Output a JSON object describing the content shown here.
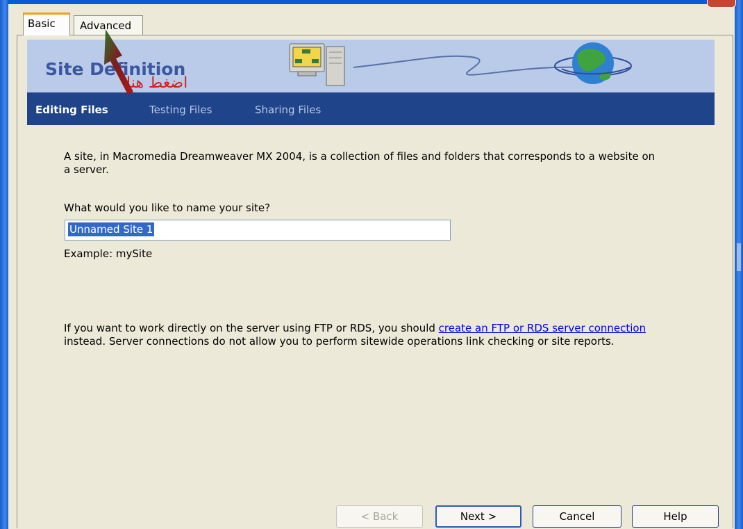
{
  "tabs": {
    "basic": "Basic",
    "advanced": "Advanced"
  },
  "banner": {
    "title": "Site Definition"
  },
  "annotation": {
    "arabic": "اضغط هنا"
  },
  "nav": {
    "items": [
      "Editing Files",
      "Testing Files",
      "Sharing Files"
    ],
    "active": "Editing Files"
  },
  "content": {
    "intro": "A site, in Macromedia Dreamweaver MX 2004, is a collection of files and folders that corresponds to a website on a server.",
    "question": "What would you like to name your site?",
    "site_name_value": "Unnamed Site 1",
    "example": "Example: mySite",
    "server_before": "If you want to work directly on the server using FTP or RDS, you should ",
    "server_link": "create an FTP or RDS server connection",
    "server_after": " instead. Server connections do not allow you to perform sitewide operations link checking or site reports."
  },
  "buttons": {
    "back": "< Back",
    "next": "Next >",
    "cancel": "Cancel",
    "help": "Help"
  },
  "colors": {
    "nav_bg": "#1f4489",
    "banner_bg": "#b9cbe9",
    "title": "#3b57a0",
    "annotation": "#d21e1e",
    "selection": "#316ac5"
  },
  "icons": [
    "computer-icon",
    "globe-icon",
    "arrow-annotation"
  ]
}
